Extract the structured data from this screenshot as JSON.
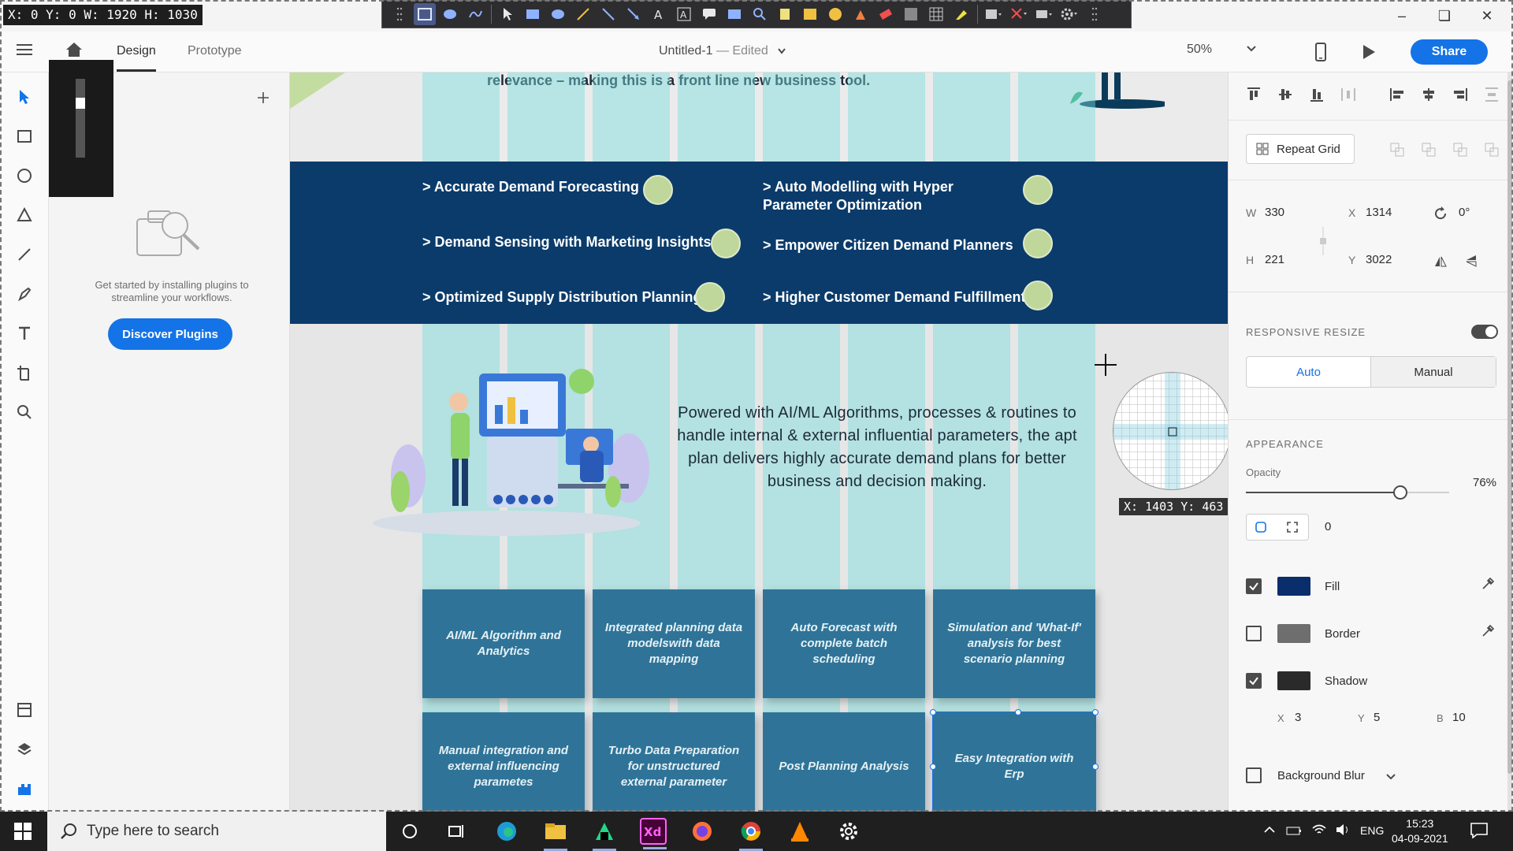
{
  "overlay": {
    "coord_readout": "X: 0 Y: 0 W: 1920 H: 1030"
  },
  "app": {
    "mode_tabs": [
      {
        "label": "Design"
      },
      {
        "label": "Prototype"
      }
    ],
    "doc_title": "Untitled-1",
    "doc_status": "Edited",
    "zoom": "50%",
    "share_label": "Share"
  },
  "plugins": {
    "empty_text": "Get started by installing plugins to streamline your workflows.",
    "discover_label": "Discover Plugins"
  },
  "canvas": {
    "top_text": "relevance – making this is a front line new business tool.",
    "band_items": [
      {
        "label": "> Accurate Demand Forecasting"
      },
      {
        "label": "> Demand Sensing with Marketing Insights"
      },
      {
        "label": "> Optimized Supply Distribution Planning"
      },
      {
        "label": "> Auto Modelling with Hyper Parameter Optimization"
      },
      {
        "label": "> Empower Citizen Demand Planners"
      },
      {
        "label": "> Higher Customer Demand Fulfillment"
      }
    ],
    "paragraph": "Powered with AI/ML Algorithms, processes & routines to handle internal & external influential parameters, the apt plan delivers highly accurate demand plans for better business and decision making.",
    "cards": [
      {
        "label": "AI/ML Algorithm and Analytics"
      },
      {
        "label": "Integrated planning data modelswith data mapping"
      },
      {
        "label": "Auto Forecast with complete batch scheduling"
      },
      {
        "label": "Simulation and 'What-If' analysis for best scenario planning"
      },
      {
        "label": "Manual integration and external influencing parametes"
      },
      {
        "label": "Turbo Data Preparation for unstructured external parameter"
      },
      {
        "label": "Post Planning Analysis"
      },
      {
        "label": "Easy Integration with Erp"
      }
    ]
  },
  "inspector": {
    "repeat_grid_label": "Repeat Grid",
    "w_label": "W",
    "w_value": "330",
    "h_label": "H",
    "h_value": "221",
    "x_label": "X",
    "x_value": "1314",
    "y_label": "Y",
    "y_value": "3022",
    "rotation": "0°",
    "responsive_title": "RESPONSIVE RESIZE",
    "responsive_on": true,
    "resize_auto": "Auto",
    "resize_manual": "Manual",
    "appearance_title": "APPEARANCE",
    "opacity_label": "Opacity",
    "opacity_value": "76%",
    "opacity_fraction": 0.76,
    "corner_radius": "0",
    "fill_label": "Fill",
    "fill_checked": true,
    "fill_color": "#0a2d6b",
    "border_label": "Border",
    "border_checked": false,
    "border_color": "#6e6e6e",
    "shadow_label": "Shadow",
    "shadow_checked": true,
    "shadow_color": "#2a2a2a",
    "shadow_x_label": "X",
    "shadow_x": "3",
    "shadow_y_label": "Y",
    "shadow_y": "5",
    "shadow_b_label": "B",
    "shadow_b": "10",
    "bg_blur_label": "Background Blur"
  },
  "magnifier": {
    "coord_readout": "X: 1403 Y: 463"
  },
  "taskbar": {
    "search_placeholder": "Type here to search",
    "language": "ENG",
    "time": "15:23",
    "date": "04-09-2021"
  },
  "colors": {
    "accent": "#1473e6",
    "band": "#0a3b6b",
    "card": "#2f7498",
    "grid_overlay": "#78dcdc"
  }
}
